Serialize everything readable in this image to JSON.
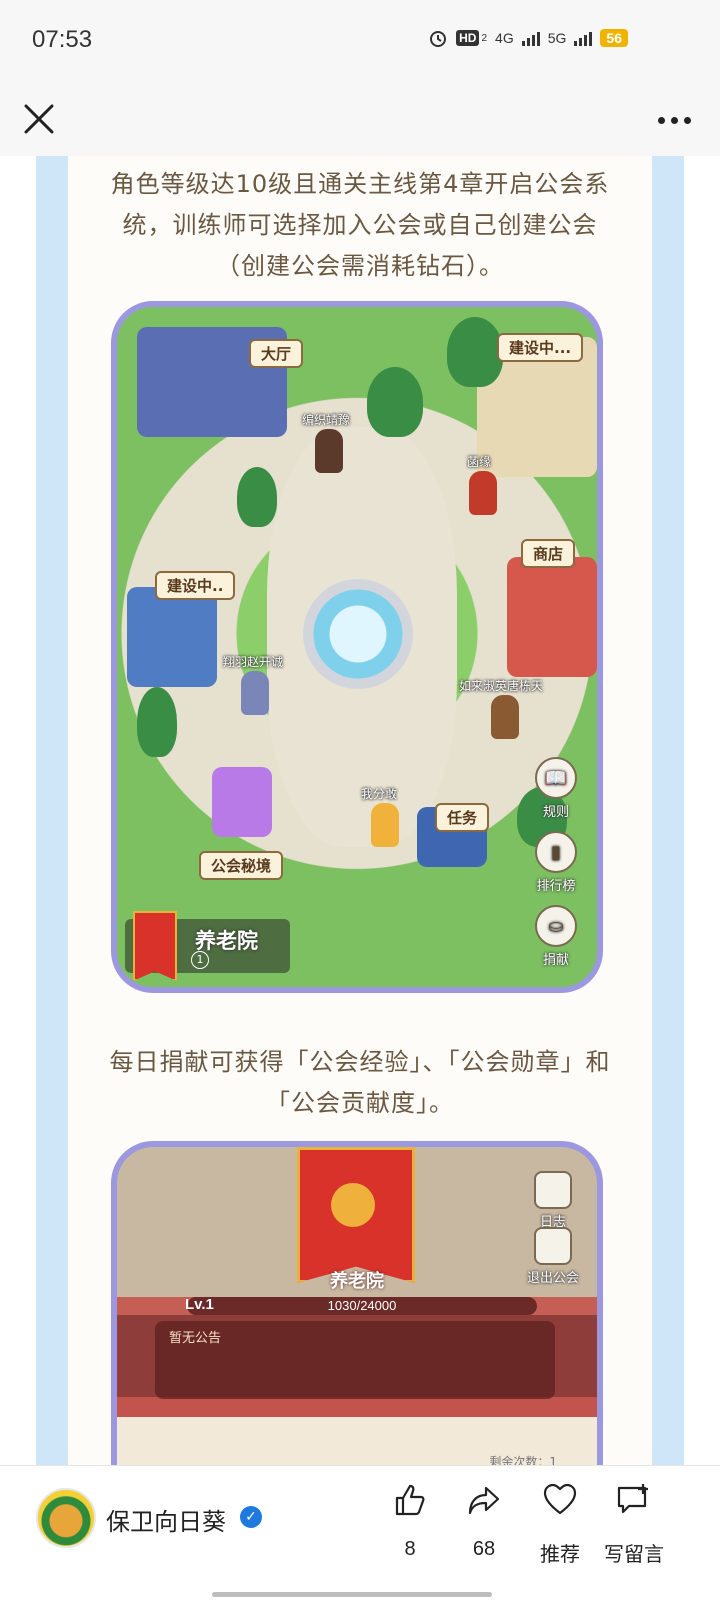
{
  "status_bar": {
    "time": "07:53",
    "hd_badge": "HD",
    "hd_sub": "2",
    "net1": "4G",
    "net2": "5G",
    "battery": "56"
  },
  "nav": {
    "close_icon": "close-icon",
    "more_icon": "more-icon"
  },
  "article": {
    "paragraph1": "角色等级达10级且通关主线第4章开启公会系统，训练师可选择加入公会或自己创建公会（创建公会需消耗钻石）。",
    "paragraph2": "每日捐献可获得「公会经验」、「公会勋章」和「公会贡献度」。",
    "screenshot1": {
      "labels": {
        "hall": "大厅",
        "building_top": "建设中...",
        "shop": "商店",
        "building_left": "建设中..",
        "mission": "任务",
        "secret_realm": "公会秘境"
      },
      "characters": {
        "c1": "编织靖豫",
        "c2": "菡缘",
        "c3": "翔羽赵开诚",
        "c4": "如来淑英唐栋天",
        "c5": "我分敢"
      },
      "side_buttons": {
        "rules": "规则",
        "ranking": "排行榜",
        "donate": "捐献"
      },
      "guild": {
        "name": "养老院",
        "level": "1"
      }
    },
    "screenshot2": {
      "guild_name": "养老院",
      "level_label": "Lv.1",
      "exp": "1030/24000",
      "notice": "暂无公告",
      "log": "日志",
      "quit": "退出公会",
      "remaining": "剩余次数：1"
    }
  },
  "bottom_bar": {
    "author": "保卫向日葵",
    "like_count": "8",
    "share_count": "68",
    "recommend_label": "推荐",
    "comment_label": "写留言"
  }
}
